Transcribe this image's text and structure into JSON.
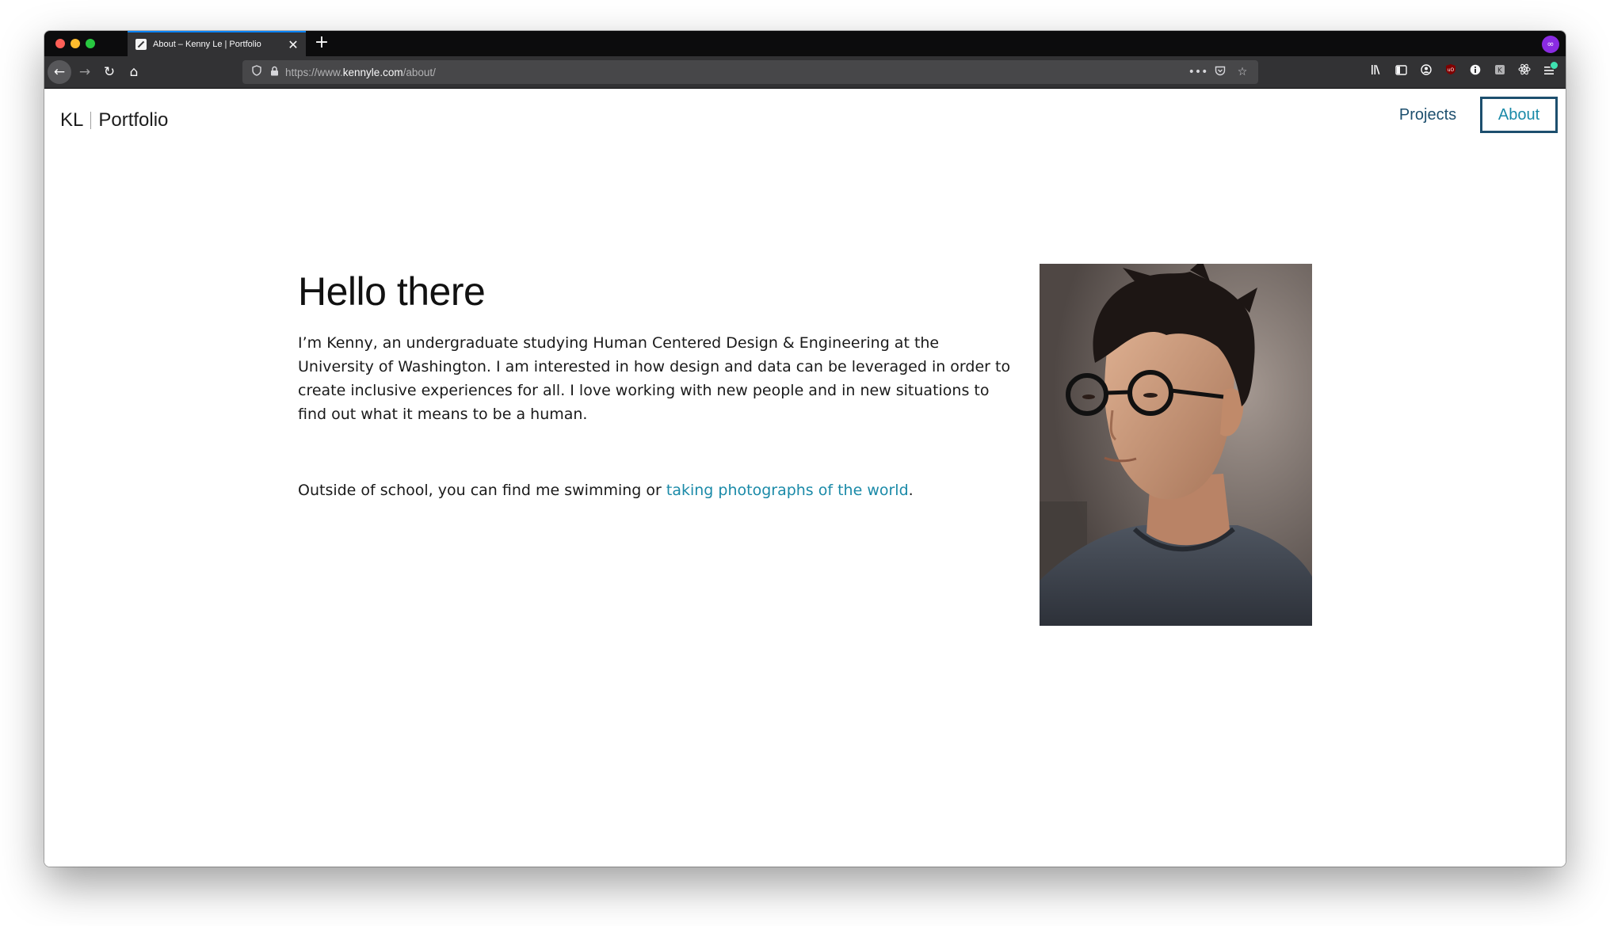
{
  "browser": {
    "tab_title": "About – Kenny Le | Portfolio",
    "tab_close": "✕",
    "new_tab": "+",
    "extension_mask": "∞",
    "url": {
      "scheme": "https://www.",
      "host": "kennyle.com",
      "path": "/about/"
    },
    "nav": {
      "back": "←",
      "forward": "→",
      "reload": "↻",
      "home": "⌂"
    },
    "url_icons": {
      "shield": "⛉",
      "lock": "🔒",
      "more": "•••",
      "pocket": "⛉",
      "bookmark": "☆"
    },
    "toolbar_icons": [
      "library-icon",
      "sidebar-icon",
      "account-icon",
      "ublock-icon",
      "info-icon",
      "extension-icon",
      "react-icon",
      "menu-icon"
    ],
    "toolbar_glyphs": {
      "library": "𝍪",
      "sidebar": "▥",
      "account": "◉",
      "ublock": "⛨",
      "info": "ⓘ",
      "ext": "▣",
      "react": "⚛",
      "menu": "☰"
    }
  },
  "site": {
    "brand_left": "KL",
    "brand_right": "Portfolio",
    "nav": {
      "projects": "Projects",
      "about": "About"
    }
  },
  "about": {
    "heading": "Hello there",
    "intro": "I’m Kenny, an undergraduate studying Human Centered Design & Engineering at the University of Washington. I am interested in how design and data can be leveraged in order to create inclusive experiences for all. I love working with new people and in new situations to find out what it means to be a human.",
    "outside_prefix": "Outside of school, you can find me swimming or ",
    "outside_link": "taking photographs of the world",
    "outside_suffix": "."
  },
  "colors": {
    "accent_teal": "#1a8aa8",
    "nav_dark_blue": "#1d4f6e",
    "browser_chrome": "#323234"
  }
}
